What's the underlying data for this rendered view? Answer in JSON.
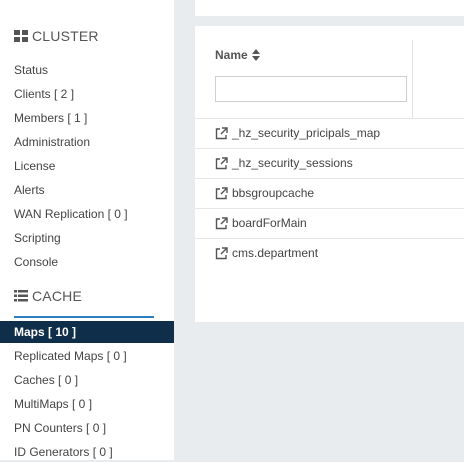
{
  "sidebar": {
    "cluster": {
      "title": "CLUSTER",
      "icon": "th-large-icon",
      "items": [
        {
          "label": "Status"
        },
        {
          "label": "Clients [ 2 ]"
        },
        {
          "label": "Members [ 1 ]"
        },
        {
          "label": "Administration"
        },
        {
          "label": "License"
        },
        {
          "label": "Alerts"
        },
        {
          "label": "WAN Replication [ 0 ]"
        },
        {
          "label": "Scripting"
        },
        {
          "label": "Console"
        }
      ]
    },
    "cache": {
      "title": "CACHE",
      "icon": "list-icon",
      "items": [
        {
          "label": "Maps [ 10 ]",
          "active": true
        },
        {
          "label": "Replicated Maps [ 0 ]"
        },
        {
          "label": "Caches [ 0 ]"
        },
        {
          "label": "MultiMaps [ 0 ]"
        },
        {
          "label": "PN Counters [ 0 ]"
        },
        {
          "label": "ID Generators [ 0 ]"
        }
      ]
    }
  },
  "table": {
    "name_header": "Name",
    "filter_placeholder": "",
    "rows": [
      {
        "name": "_hz_security_pricipals_map"
      },
      {
        "name": "_hz_security_sessions"
      },
      {
        "name": "bbsgroupcache"
      },
      {
        "name": "boardForMain"
      },
      {
        "name": "cms.department"
      }
    ]
  },
  "colors": {
    "active_bg": "#0f2e4a",
    "accent": "#2d7ec1",
    "page_bg": "#e9ecef"
  }
}
